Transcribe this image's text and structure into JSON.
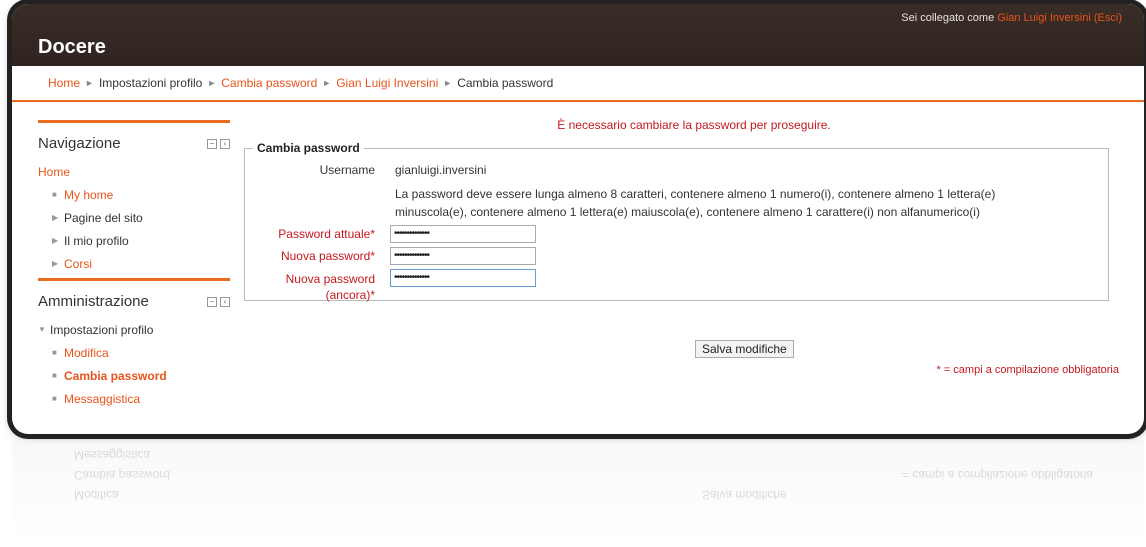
{
  "header": {
    "site_name": "Docere",
    "login_prefix": "Sei collegato come",
    "login_user": "Gian Luigi Inversini",
    "logout_label": "(Esci)"
  },
  "breadcrumb": [
    "Home",
    "Impostazioni profilo",
    "Cambia password",
    "Gian Luigi Inversini",
    "Cambia password"
  ],
  "navigation": {
    "title": "Navigazione",
    "items": [
      {
        "label": "Home"
      },
      {
        "label": "My home"
      },
      {
        "label": "Pagine del sito"
      },
      {
        "label": "Il mio profilo"
      },
      {
        "label": "Corsi"
      }
    ]
  },
  "administration": {
    "title": "Amministrazione",
    "items": [
      {
        "label": "Impostazioni profilo"
      },
      {
        "label": "Modifica"
      },
      {
        "label": "Cambia password"
      },
      {
        "label": "Messaggistica"
      }
    ]
  },
  "main": {
    "notice": "È necessario cambiare la password per proseguire.",
    "fieldset_title": "Cambia password",
    "username_label": "Username",
    "username_value": "gianluigi.inversini",
    "policy_line1": "La password deve essere lunga almeno 8 caratteri, contenere almeno 1 numero(i), contenere almeno 1 lettera(e)",
    "policy_line2": "minuscola(e), contenere almeno 1 lettera(e) maiuscola(e), contenere almeno 1 carattere(i) non alfanumerico(i)",
    "current_pw_label": "Password attuale",
    "new_pw_label": "Nuova password",
    "new_pw_again_label_1": "Nuova password",
    "new_pw_again_label_2": "(ancora)",
    "required_star": "*",
    "masked_value": "••••••••••••••",
    "save_label": "Salva modifiche",
    "required_note": "= campi a compilazione obbligatoria"
  },
  "colors": {
    "accent": "#e8541b",
    "required": "#c2181f",
    "header_bg": "#342823"
  }
}
